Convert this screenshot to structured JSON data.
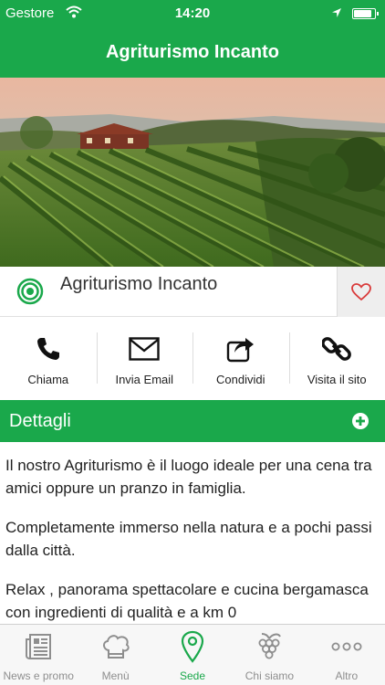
{
  "status_bar": {
    "carrier": "Gestore",
    "time": "14:20",
    "battery_level": 0.9
  },
  "nav": {
    "title": "Agriturismo Incanto"
  },
  "place": {
    "name": "Agriturismo Incanto"
  },
  "actions": [
    {
      "label": "Chiama",
      "icon": "phone-icon"
    },
    {
      "label": "Invia Email",
      "icon": "envelope-icon"
    },
    {
      "label": "Condividi",
      "icon": "share-icon"
    },
    {
      "label": "Visita il sito",
      "icon": "link-icon"
    }
  ],
  "details": {
    "header": "Dettagli",
    "paragraphs": [
      "Il nostro Agriturismo è il luogo ideale per una cena tra amici oppure un pranzo in famiglia.",
      "Completamente immerso nella natura e a pochi passi dalla città.",
      "Relax , panorama spettacolare e cucina bergamasca con ingredienti di qualità e a km 0"
    ]
  },
  "tabs": [
    {
      "label": "News e promo",
      "icon": "newspaper-icon",
      "active": false
    },
    {
      "label": "Menù",
      "icon": "chef-hat-icon",
      "active": false
    },
    {
      "label": "Sede",
      "icon": "map-pin-icon",
      "active": true
    },
    {
      "label": "Chi siamo",
      "icon": "grapes-icon",
      "active": false
    },
    {
      "label": "Altro",
      "icon": "more-icon",
      "active": false
    }
  ],
  "colors": {
    "brand_green": "#1aa84b",
    "tab_inactive": "#8e8e8e",
    "favorite_red": "#d93a3a"
  }
}
